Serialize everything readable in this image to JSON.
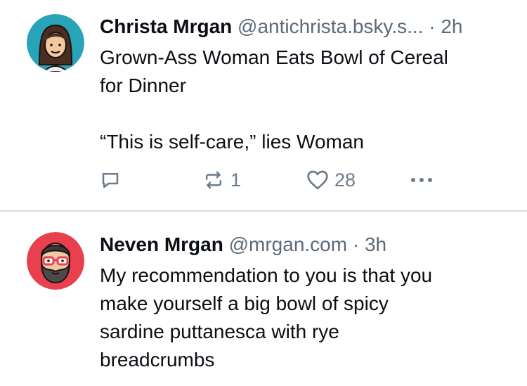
{
  "posts": [
    {
      "author": "Christa Mrgan",
      "handle": "@antichrista.bsky.s...",
      "separator": "·",
      "time": "2h",
      "text": "Grown-Ass Woman Eats Bowl of Cereal\nfor Dinner\n\n“This is self-care,” lies Woman",
      "repost_count": "1",
      "like_count": "28",
      "avatar_bg": "#28a3b8"
    },
    {
      "author": "Neven Mrgan",
      "handle": "@mrgan.com",
      "separator": "·",
      "time": "3h",
      "text": "My recommendation to you is that you\nmake yourself a big bowl of spicy\nsardine puttanesca with rye\nbreadcrumbs",
      "avatar_bg": "#e8404f"
    }
  ],
  "icons": {
    "reply": "reply-icon",
    "repost": "repost-icon",
    "like": "heart-icon",
    "more": "more-icon"
  },
  "colors": {
    "text": "#0b0f14",
    "muted": "#5b6b7a",
    "action": "#6c7b8a",
    "divider": "#d6dde4"
  }
}
